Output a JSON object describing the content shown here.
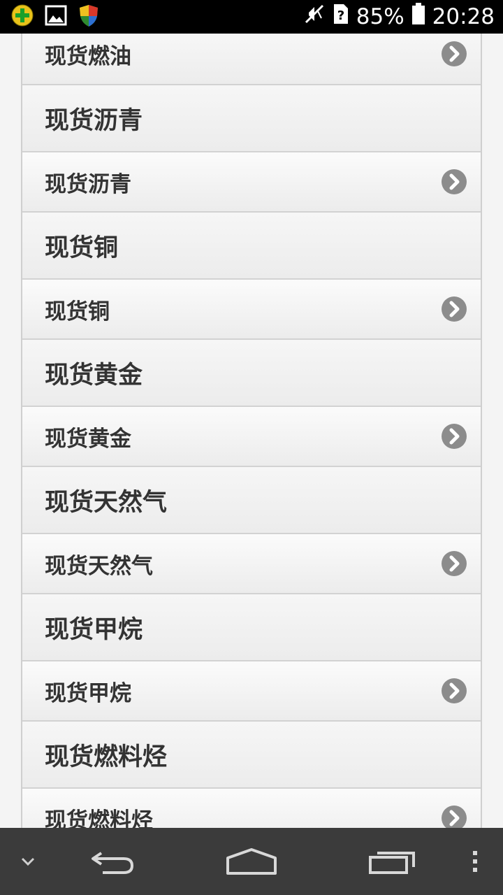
{
  "status_bar": {
    "icons_left": [
      "plus-badge-icon",
      "image-icon",
      "shield-icon"
    ],
    "icons_right": [
      "mute-icon",
      "sim-unknown-icon",
      "battery-icon"
    ],
    "battery": "85%",
    "time": "20:28"
  },
  "list": {
    "rows": [
      {
        "type": "item",
        "label": "现货燃油"
      },
      {
        "type": "divider",
        "label": "现货沥青"
      },
      {
        "type": "item",
        "label": "现货沥青"
      },
      {
        "type": "divider",
        "label": "现货铜"
      },
      {
        "type": "item",
        "label": "现货铜"
      },
      {
        "type": "divider",
        "label": "现货黄金"
      },
      {
        "type": "item",
        "label": "现货黄金"
      },
      {
        "type": "divider",
        "label": "现货天然气"
      },
      {
        "type": "item",
        "label": "现货天然气"
      },
      {
        "type": "divider",
        "label": "现货甲烷"
      },
      {
        "type": "item",
        "label": "现货甲烷"
      },
      {
        "type": "divider",
        "label": "现货燃料烃"
      },
      {
        "type": "item",
        "label": "现货燃料烃"
      }
    ]
  },
  "nav_bar": {
    "buttons": [
      "chevron-down-icon",
      "back-icon",
      "home-icon",
      "recent-apps-icon",
      "overflow-menu-icon"
    ]
  }
}
